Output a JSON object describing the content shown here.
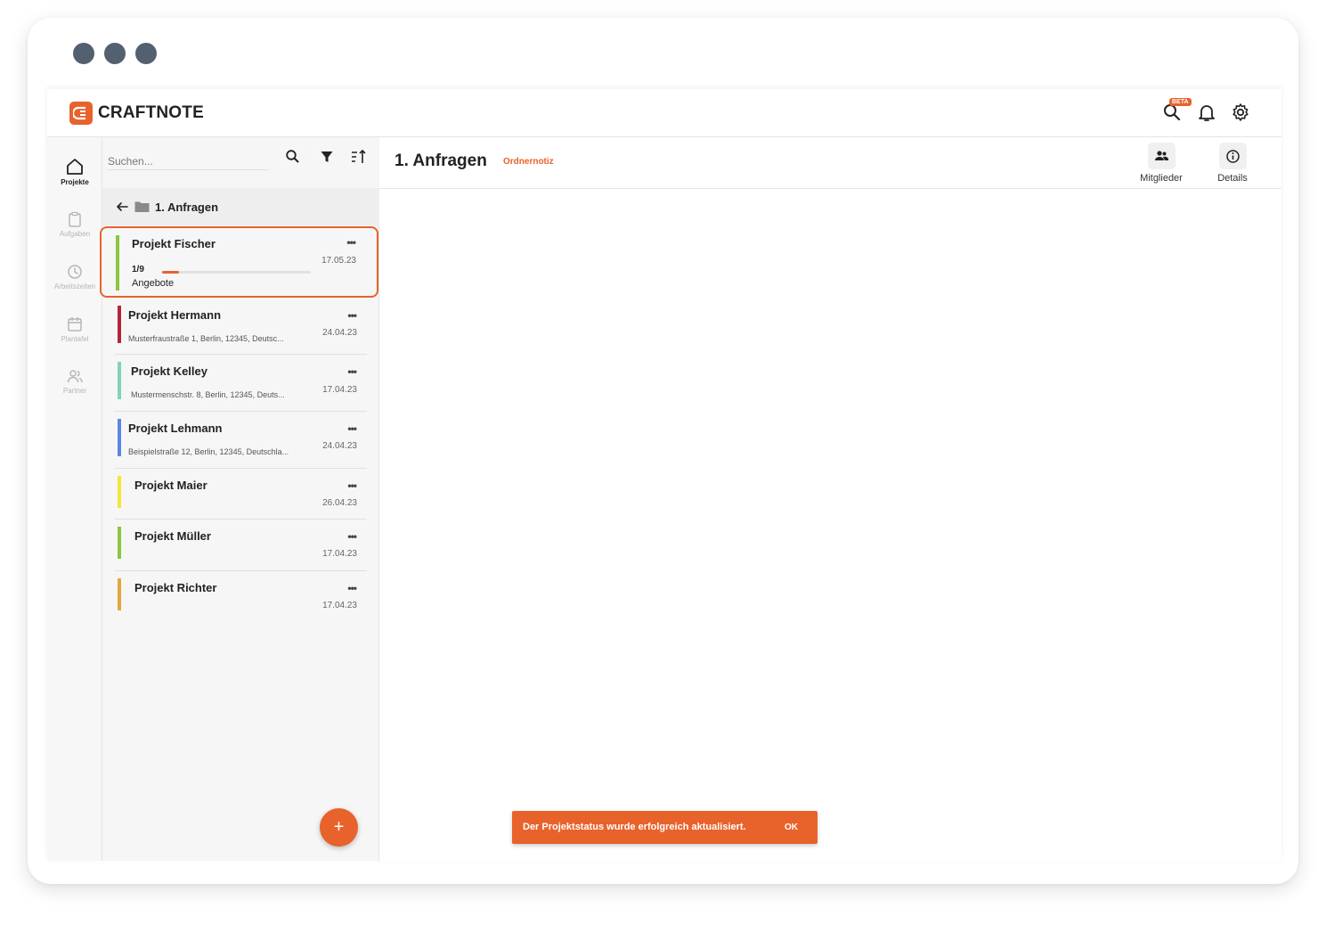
{
  "window": {
    "controls": [
      "dot",
      "dot",
      "dot"
    ]
  },
  "brand": {
    "name": "CRAFTNOTE",
    "accent": "#e8622c"
  },
  "topbar": {
    "search_badge": "BETA",
    "icons": [
      "search-icon",
      "bell-icon",
      "gear-icon"
    ]
  },
  "nav": {
    "items": [
      {
        "label": "Projekte",
        "icon": "home-icon",
        "active": true
      },
      {
        "label": "Aufgaben",
        "icon": "clipboard-icon",
        "active": false
      },
      {
        "label": "Arbeitszeiten",
        "icon": "clock-icon",
        "active": false
      },
      {
        "label": "Plantafel",
        "icon": "calendar-icon",
        "active": false
      },
      {
        "label": "Partner",
        "icon": "people-icon",
        "active": false
      }
    ]
  },
  "list": {
    "search_placeholder": "Suchen...",
    "folder": "1. Anfragen",
    "projects": [
      {
        "name": "Projekt Fischer",
        "date": "17.05.23",
        "progress_label": "1/9",
        "progress": 0.111,
        "status": "Angebote",
        "color": "#8cc63f",
        "selected": true
      },
      {
        "name": "Projekt Hermann",
        "date": "24.04.23",
        "address": "Musterfraustraße 1, Berlin, 12345, Deutsc...",
        "color": "#b3263a"
      },
      {
        "name": "Projekt Kelley",
        "date": "17.04.23",
        "address": "Mustermenschstr. 8, Berlin, 12345, Deuts...",
        "color": "#7fd3b8"
      },
      {
        "name": "Projekt Lehmann",
        "date": "24.04.23",
        "address": "Beispielstraße 12, Berlin, 12345, Deutschla...",
        "color": "#5b86e5"
      },
      {
        "name": "Projekt Maier",
        "date": "26.04.23",
        "color": "#f2e63a"
      },
      {
        "name": "Projekt Müller",
        "date": "17.04.23",
        "color": "#8cc63f"
      },
      {
        "name": "Projekt Richter",
        "date": "17.04.23",
        "color": "#e0a83c"
      }
    ],
    "menu_glyph": "•••",
    "add_glyph": "+"
  },
  "main": {
    "title": "1. Anfragen",
    "note_link": "Ordnernotiz",
    "header_buttons": [
      {
        "label": "Mitglieder",
        "icon": "members-icon"
      },
      {
        "label": "Details",
        "icon": "info-icon"
      }
    ]
  },
  "toast": {
    "message": "Der Projektstatus wurde erfolgreich aktualisiert.",
    "action": "OK"
  }
}
